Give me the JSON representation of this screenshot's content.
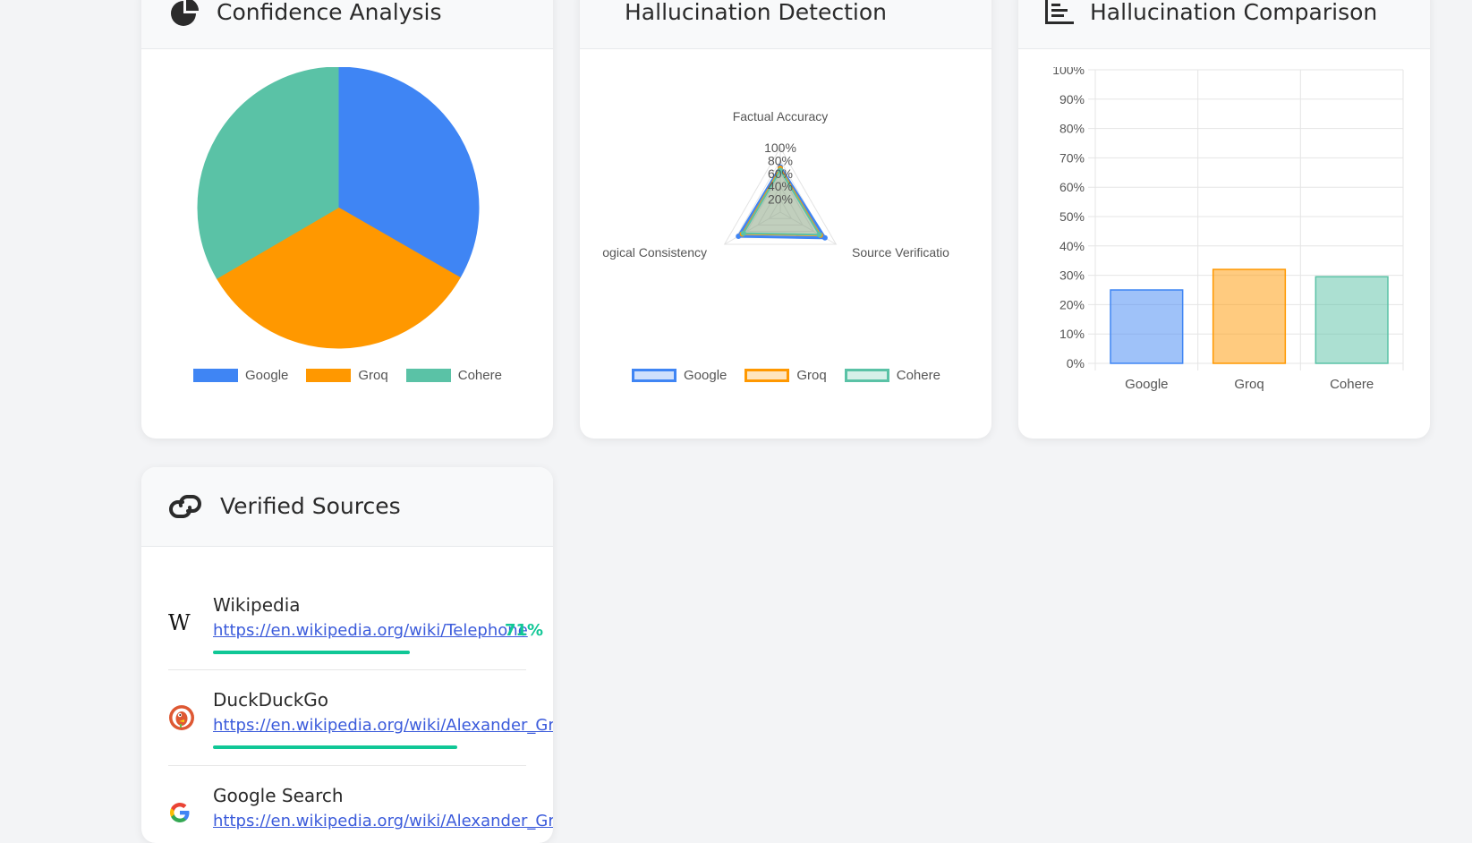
{
  "cards": {
    "confidence": {
      "title": "Confidence Analysis",
      "icon": "pie-chart-icon"
    },
    "hallucination_detection": {
      "title": "Hallucination Detection"
    },
    "hallucination_comparison": {
      "title": "Hallucination Comparison",
      "icon": "bar-chart-icon"
    },
    "verified_sources": {
      "title": "Verified Sources",
      "icon": "link-icon"
    }
  },
  "colors": {
    "google": "#3f85f4",
    "groq": "#ff9800",
    "cohere": "#5ac2a6",
    "success": "#10c796",
    "link": "#3b5bdb"
  },
  "chart_data": [
    {
      "type": "pie",
      "categories": [
        "Google",
        "Groq",
        "Cohere"
      ],
      "values": [
        33.3,
        33.3,
        33.4
      ],
      "legend": "bottom"
    },
    {
      "type": "radar",
      "axes": [
        "Factual Accuracy",
        "Source Verificatio",
        "ogical Consistency"
      ],
      "tick_labels": [
        "20%",
        "40%",
        "60%",
        "80%",
        "100%"
      ],
      "series": [
        {
          "name": "Google",
          "values": [
            70,
            80,
            75
          ]
        },
        {
          "name": "Groq",
          "values": [
            68,
            72,
            68
          ]
        },
        {
          "name": "Cohere",
          "values": [
            65,
            70,
            66
          ]
        }
      ],
      "legend": "bottom"
    },
    {
      "type": "bar",
      "categories": [
        "Google",
        "Groq",
        "Cohere"
      ],
      "values": [
        25,
        32,
        29.5
      ],
      "yticks": [
        "0%",
        "10%",
        "20%",
        "30%",
        "40%",
        "50%",
        "60%",
        "70%",
        "80%",
        "90%",
        "100%"
      ],
      "ylim": [
        0,
        100
      ],
      "grid": true
    }
  ],
  "sources": [
    {
      "name": "Wikipedia",
      "url": "https://en.wikipedia.org/wiki/Telephone",
      "score": "71%",
      "bar_fraction": 0.71,
      "icon": "wikipedia-icon",
      "icon_glyph": "W"
    },
    {
      "name": "DuckDuckGo",
      "url": "https://en.wikipedia.org/wiki/Alexander_Graham_",
      "score": "",
      "bar_fraction": 0.88,
      "icon": "duckduckgo-icon"
    },
    {
      "name": "Google Search",
      "url": "https://en.wikipedia.org/wiki/Alexander_Graham",
      "score": "",
      "bar_fraction": 0,
      "icon": "google-icon"
    }
  ]
}
